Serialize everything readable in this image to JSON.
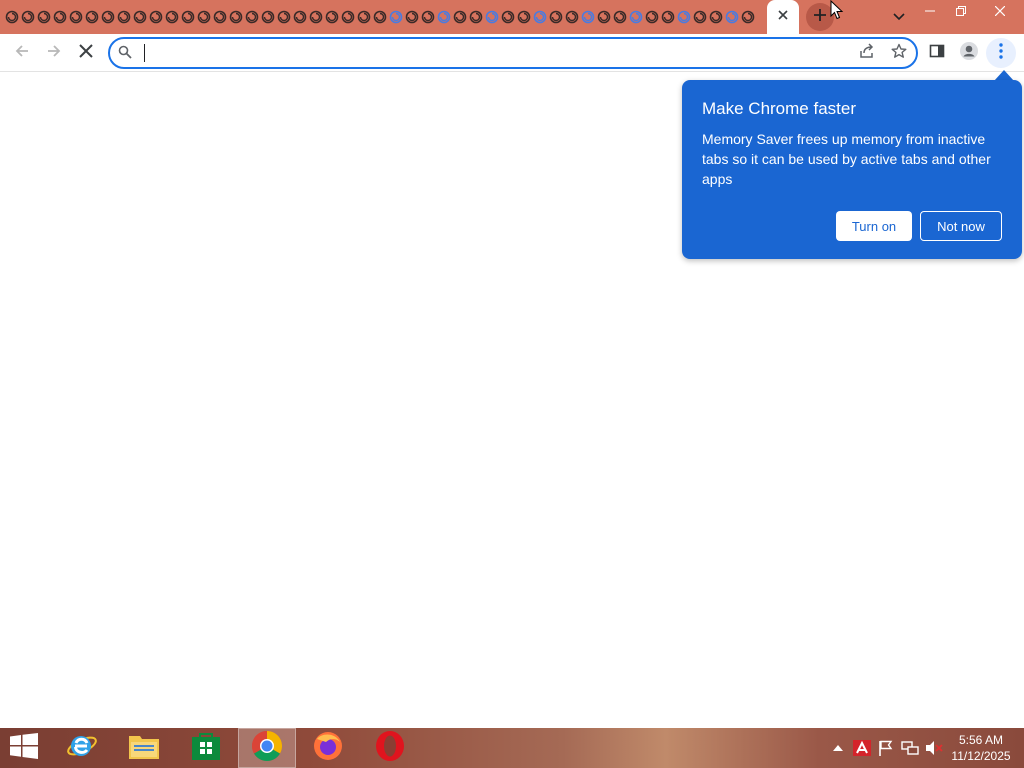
{
  "browser": {
    "tab_count": 47,
    "active_tab_close_label": "×",
    "omnibox": {
      "value": "",
      "placeholder": ""
    }
  },
  "bubble": {
    "title": "Make Chrome faster",
    "body": "Memory Saver frees up memory from inactive tabs so it can be used by active tabs and other apps",
    "turn_on_label": "Turn on",
    "not_now_label": "Not now"
  },
  "taskbar": {
    "apps": [
      "start-icon",
      "internet-explorer-icon",
      "file-explorer-icon",
      "store-icon",
      "chrome-icon",
      "firefox-icon",
      "opera-icon"
    ],
    "clock_time": "5:56 AM",
    "clock_date": "11/12/2025"
  },
  "colors": {
    "tabstrip": "#d6735e",
    "bubble": "#1a66d2",
    "omnibox_focus": "#1a73e8"
  }
}
